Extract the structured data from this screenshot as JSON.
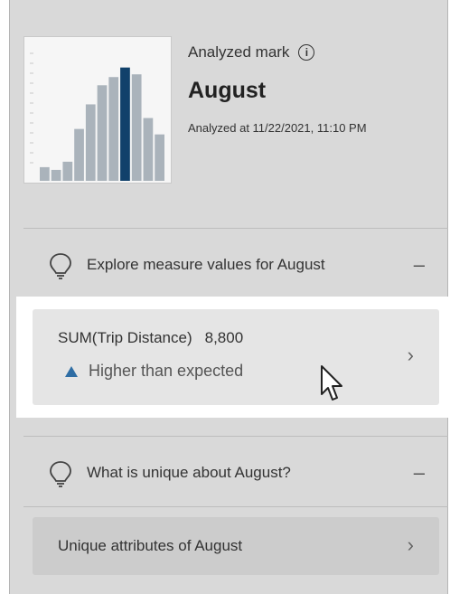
{
  "header": {
    "label": "Analyzed mark",
    "title": "August",
    "timestamp": "Analyzed at 11/22/2021, 11:10 PM"
  },
  "thumbnail": {
    "bar_color": "#aab3bb",
    "highlight_color": "#11416b",
    "bars": [
      0.1,
      0.08,
      0.14,
      0.38,
      0.56,
      0.7,
      0.76,
      0.83,
      0.78,
      0.46,
      0.34
    ],
    "highlight_index": 7
  },
  "section_measures": {
    "label": "Explore measure values for August",
    "collapse_icon": "minus-icon"
  },
  "measure_card": {
    "field": "SUM(Trip Distance)",
    "value": "8,800",
    "trend": "Higher than expected",
    "trend_color": "#2e6da4"
  },
  "section_unique": {
    "label": "What is unique about August?",
    "collapse_icon": "minus-icon"
  },
  "unique_card": {
    "label": "Unique attributes of August"
  }
}
